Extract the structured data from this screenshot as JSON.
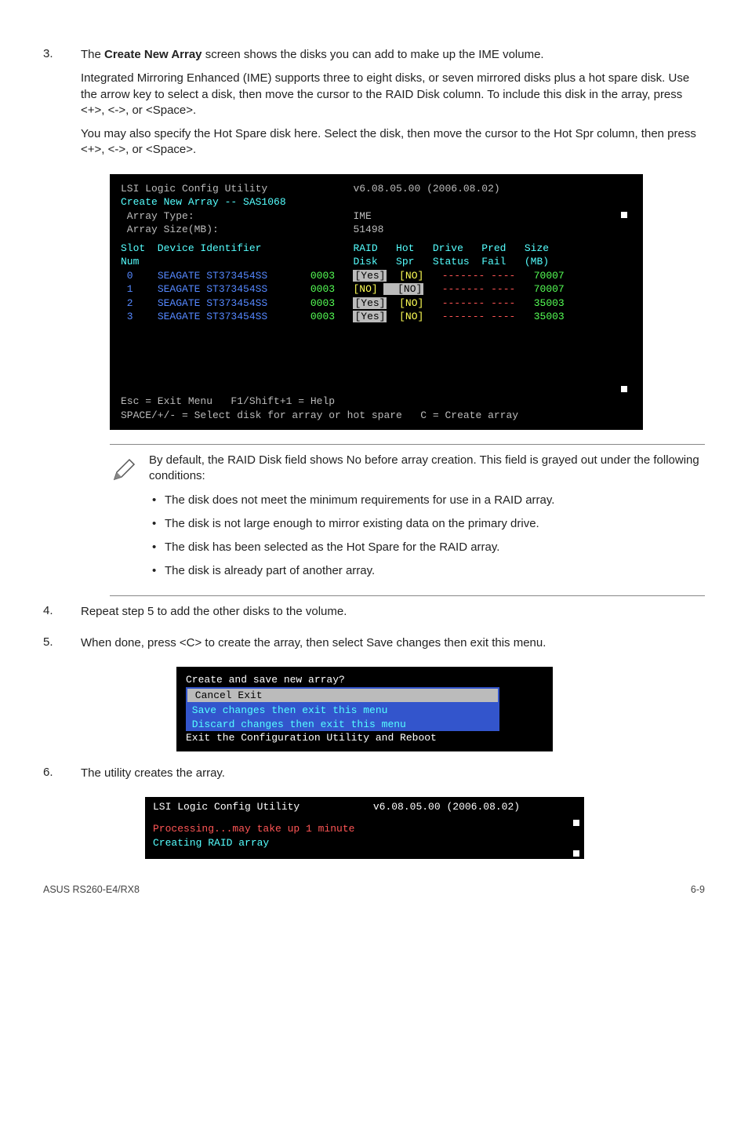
{
  "step3": {
    "num": "3.",
    "p1a": "The ",
    "p1b": "Create New Array",
    "p1c": " screen shows the disks you can add to make up the IME volume.",
    "p2": "Integrated Mirroring Enhanced (IME) supports  three to eight disks, or seven mirrored disks plus a hot spare disk. Use the arrow key to select a disk, then move the cursor to the RAID Disk column. To include this disk in the array, press <+>, <->, or <Space>.",
    "p3": "You may also specify the Hot Spare disk here. Select the disk, then move the cursor to the Hot Spr column, then press <+>, <->, or <Space>."
  },
  "term1": {
    "title": "LSI Logic Config Utility              v6.08.05.00 (2006.08.02)",
    "subtitle": "Create New Array -- SAS1068",
    "arrtype_lbl": " Array Type:                          IME",
    "arrsize_lbl": " Array Size(MB):                      51498",
    "hdr1": "Slot  Device Identifier               RAID   Hot   Drive   Pred   Size",
    "hdr2": "Num                                   Disk   Spr   Status  Fail   (MB)",
    "rows": [
      {
        "slot": " 0    ",
        "dev": "SEAGATE ST373454SS       ",
        "rev": "0003   ",
        "raid": "[Yes]",
        "hot": "  [NO]",
        "drv": "   -------",
        "pred": " ----",
        "size": "   70007"
      },
      {
        "slot": " 1    ",
        "dev": "SEAGATE ST373454SS       ",
        "rev": "0003   ",
        "raid": "[NO] ",
        "hot": "  [NO]",
        "drv": "   -------",
        "pred": " ----",
        "size": "   70007"
      },
      {
        "slot": " 2    ",
        "dev": "SEAGATE ST373454SS       ",
        "rev": "0003   ",
        "raid": "[Yes]",
        "hot": "  [NO]",
        "drv": "   -------",
        "pred": " ----",
        "size": "   35003"
      },
      {
        "slot": " 3    ",
        "dev": "SEAGATE ST373454SS       ",
        "rev": "0003   ",
        "raid": "[Yes]",
        "hot": "  [NO]",
        "drv": "   -------",
        "pred": " ----",
        "size": "   35003"
      }
    ],
    "foot1": "Esc = Exit Menu   F1/Shift+1 = Help",
    "foot2": "SPACE/+/- = Select disk for array or hot spare   C = Create array"
  },
  "note": {
    "p": "By default, the RAID Disk field shows No before array creation. This field is grayed out under the following conditions:",
    "items": [
      "The disk does not meet the  minimum requirements for use in a RAID array.",
      "The disk is not large enough to mirror existing data on the primary drive.",
      "The disk has been selected as the Hot Spare for the RAID array.",
      "The disk is already part of another array."
    ]
  },
  "step4": {
    "num": "4.",
    "p1": "Repeat step 5 to add the other disks to the volume."
  },
  "step5": {
    "num": "5.",
    "p1": "When done, press <C> to create the array, then select Save changes then exit this menu."
  },
  "savebox": {
    "title": "Create and save new array?",
    "opt1": " Cancel Exit",
    "opt2": " Save changes then exit this menu",
    "opt3": " Discard changes then exit this menu",
    "foot": "Exit the Configuration Utility and Reboot"
  },
  "step6": {
    "num": "6.",
    "p1": "The utility creates the array."
  },
  "procbox": {
    "title": "LSI Logic Config Utility            v6.08.05.00 (2006.08.02)",
    "l1": "Processing...may take up 1 minute",
    "l2": "Creating RAID array"
  },
  "footer": {
    "left": "ASUS RS260-E4/RX8",
    "right": "6-9"
  }
}
